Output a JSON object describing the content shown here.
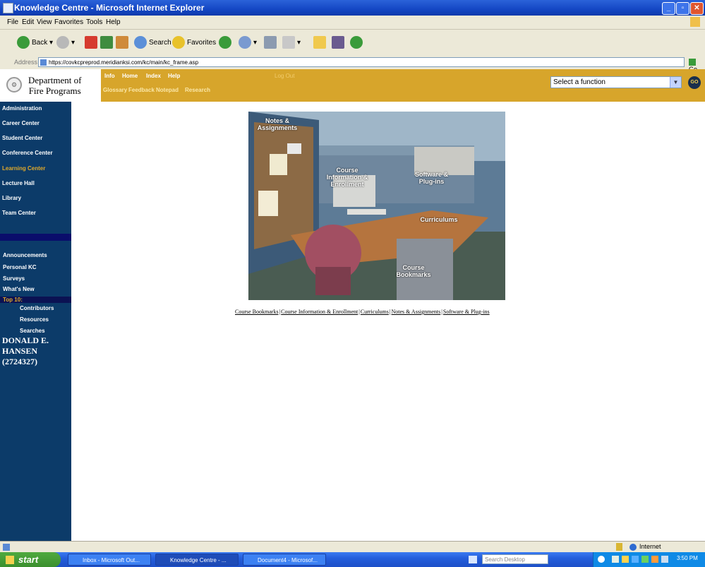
{
  "window": {
    "title": "Knowledge Centre - Microsoft Internet Explorer"
  },
  "menu": [
    "File",
    "Edit",
    "View",
    "Favorites",
    "Tools",
    "Help"
  ],
  "toolbar": {
    "back_label": "Back",
    "search_label": "Search",
    "favorites_label": "Favorites"
  },
  "address": {
    "label": "Address",
    "url": "https://covkcpreprod.meridianksi.com/kc/main/kc_frame.asp",
    "go_label": "Go"
  },
  "header": {
    "logo_line1": "Department of",
    "logo_line2": "Fire Programs",
    "nav_row1": [
      "Info",
      "Home",
      "Index",
      "Help"
    ],
    "nav_row2": [
      "Glossary",
      "Feedback",
      "Notepad",
      "Research"
    ],
    "logout_label": "Log Out",
    "function_select_value": "Select a function",
    "go_button_label": "GO"
  },
  "sidebar": {
    "items": [
      "Administration",
      "Career Center",
      "Student Center",
      "Conference Center",
      "Learning Center",
      "Lecture Hall",
      "Library",
      "Team Center"
    ],
    "active_item": "Learning Center",
    "active_color": "#e0a92b",
    "secondary_items": [
      "Announcements",
      "Personal KC",
      "Surveys",
      "What's New"
    ],
    "top10_label": "Top 10:",
    "top10_items": [
      "Contributors",
      "Resources",
      "Searches"
    ],
    "user_name_line1": "DONALD E.",
    "user_name_line2": "HANSEN",
    "user_id": "(2724327)"
  },
  "imagemap": {
    "hotspots": {
      "notes": "Notes & Assignments",
      "course_info": "Course Information & Enrollment",
      "software": "Software & Plug-ins",
      "curriculums": "Curriculums",
      "bookmarks": "Course Bookmarks"
    }
  },
  "links": [
    "Course Bookmarks",
    "Course Information & Enrollment",
    "Curriculums",
    "Notes & Assignments",
    "Software & Plug-ins"
  ],
  "statusbar": {
    "zone": "Internet"
  },
  "taskbar": {
    "start_label": "start",
    "tasks": [
      "Inbox - Microsoft Out...",
      "Knowledge Centre - ...",
      "Document4 - Microsof..."
    ],
    "search_placeholder": "Search Desktop",
    "clock": "3:50 PM"
  }
}
